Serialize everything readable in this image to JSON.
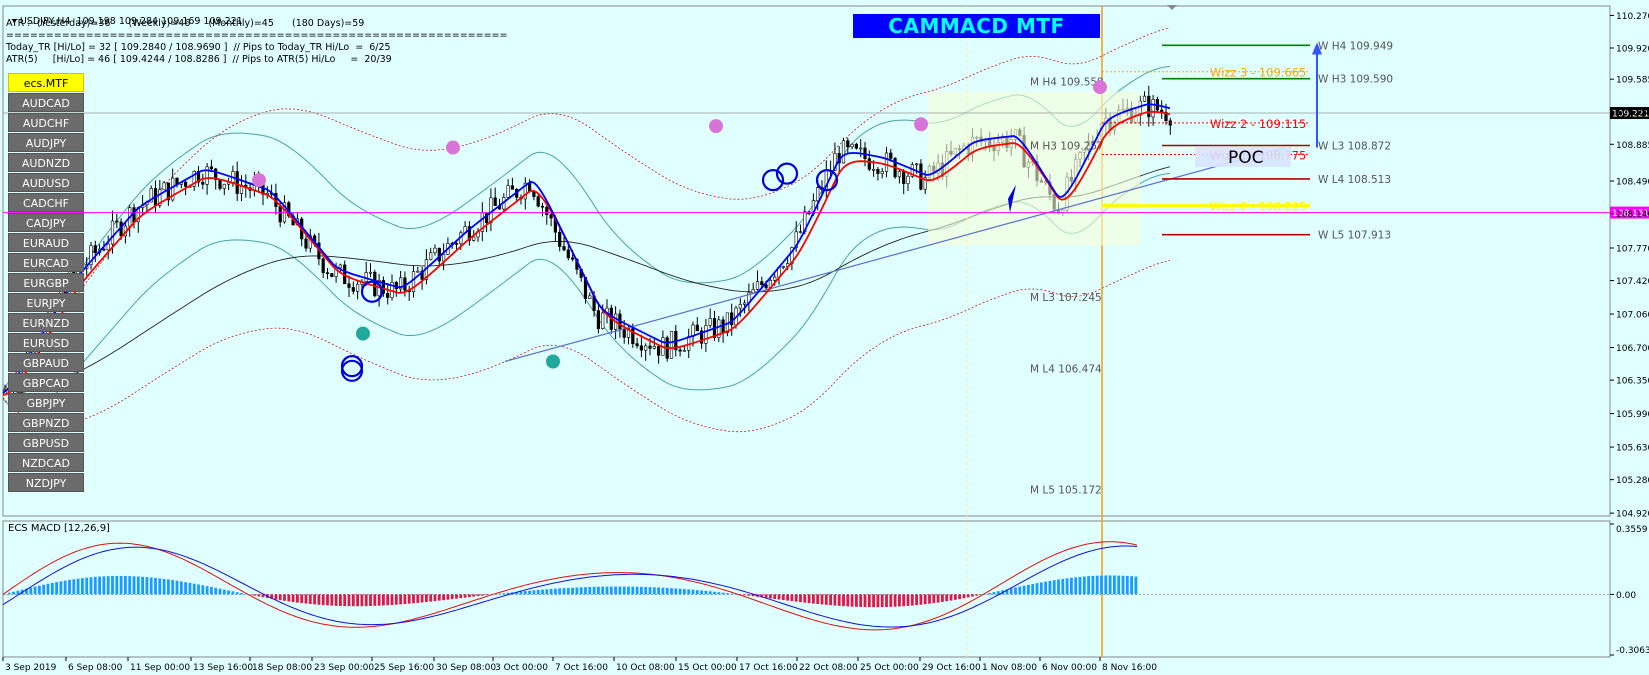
{
  "header": {
    "symbol_line": "USDJPY,H4  109.198 109.284 109.169 109.221",
    "atr_line": "ATR :- (Yesterday)=36      (Weekly)=46      (Monthly)=45      (180 Days)=59",
    "separator": "===============================================================",
    "today_line": "Today_TR [Hi/Lo] = 32 [ 109.2840 / 108.9690 ]  // Pips to Today_TR Hi/Lo  =  6/25",
    "atr5_line": "ATR(5)     [Hi/Lo] = 46 [ 109.4244 / 108.8286 ]  // Pips to ATR(5) Hi/Lo     =  20/39"
  },
  "title": "CAMMACD MTF",
  "symbols": [
    "ecs.MTF",
    "AUDCAD",
    "AUDCHF",
    "AUDJPY",
    "AUDNZD",
    "AUDUSD",
    "CADCHF",
    "CADJPY",
    "EURAUD",
    "EURCAD",
    "EURGBP",
    "EURJPY",
    "EURNZD",
    "EURUSD",
    "GBPAUD",
    "GBPCAD",
    "GBPJPY",
    "GBPNZD",
    "GBPUSD",
    "NZDCAD",
    "NZDJPY"
  ],
  "active_symbol": "ecs.MTF",
  "colors": {
    "background": "#e0ffff",
    "bull_line": "#0000ff",
    "bear_line": "#ff0000",
    "price_tag": "#ff00ff",
    "current_tag": "#000000",
    "title_bg": "#0000ff",
    "title_fg": "#00ffff"
  },
  "chart_data": [
    {
      "type": "line",
      "name": "USDJPY,H4",
      "ylim": [
        104.9,
        110.35
      ],
      "y_ticks": [
        "110.270",
        "109.920",
        "109.585",
        "109.235",
        "108.885",
        "108.490",
        "108.140",
        "107.770",
        "107.420",
        "107.060",
        "106.700",
        "106.350",
        "105.990",
        "105.630",
        "105.280",
        "104.920"
      ],
      "y_tick_values": [
        110.27,
        109.92,
        109.585,
        109.235,
        108.885,
        108.49,
        108.14,
        107.77,
        107.42,
        107.06,
        106.7,
        106.35,
        105.99,
        105.63,
        105.28,
        104.92
      ],
      "x_ticks": [
        "3 Sep 2019",
        "6 Sep 08:00",
        "11 Sep 00:00",
        "13 Sep 16:00",
        "18 Sep 08:00",
        "23 Sep 00:00",
        "25 Sep 16:00",
        "30 Sep 08:00",
        "3 Oct 00:00",
        "7 Oct 16:00",
        "10 Oct 08:00",
        "15 Oct 00:00",
        "17 Oct 16:00",
        "22 Oct 08:00",
        "25 Oct 00:00",
        "29 Oct 16:00",
        "1 Nov 08:00",
        "6 Nov 00:00",
        "8 Nov 16:00"
      ],
      "price_series": {
        "x": [
          0,
          15,
          30,
          45,
          60,
          75,
          90,
          105,
          120,
          135,
          150,
          165,
          180,
          190,
          200,
          210,
          220,
          230,
          240,
          250,
          260,
          266
        ],
        "y": [
          106.2,
          107.4,
          108.2,
          108.6,
          108.35,
          107.5,
          107.3,
          107.95,
          108.5,
          107.05,
          106.7,
          106.95,
          107.8,
          108.8,
          108.7,
          108.5,
          108.9,
          108.95,
          108.2,
          109.15,
          109.3,
          109.22
        ]
      },
      "current_price": "109.221",
      "horizontal_line_price": "108.151",
      "pivot_labels": [
        {
          "text": "M  H4 109.558",
          "value": 109.558
        },
        {
          "text": "M  H3 109.257",
          "value": 108.872
        },
        {
          "text": "M  L3 107.245",
          "value": 107.245
        },
        {
          "text": "M  L4 106.474",
          "value": 106.474
        },
        {
          "text": "M  L5 105.172",
          "value": 105.172
        },
        {
          "text": "W  H4 109.949",
          "value": 109.949
        },
        {
          "text": "W  H3 109.590",
          "value": 109.59
        },
        {
          "text": "W  L3 108.872",
          "value": 108.872
        },
        {
          "text": "W  L4 108.513",
          "value": 108.513
        },
        {
          "text": "W  L5 107.913",
          "value": 107.913
        }
      ],
      "wizz_labels": [
        {
          "text": "Wizz 3 - 109.665",
          "value": 109.665,
          "color": "#ffa500"
        },
        {
          "text": "Wizz 2 - 109.115",
          "value": 109.115,
          "color": "#ff0000"
        },
        {
          "text": "Wizz 1 - 108.775",
          "value": 108.775,
          "color": "#ff0000"
        },
        {
          "text": "Wizz 0 - 108.225",
          "value": 108.225,
          "color": "#ffff00"
        }
      ],
      "poc_label": "POC",
      "poc_value": 108.77
    },
    {
      "type": "bar",
      "name": "ECS MACD [12,26,9]",
      "label": "ECS MACD [12,26,9]",
      "ylim": [
        -0.30634,
        0.3559
      ],
      "y_ticks": [
        "0.3559",
        "0.00",
        "-0.30634"
      ],
      "y_tick_values": [
        0.3559,
        0.0,
        -0.30634
      ]
    }
  ]
}
